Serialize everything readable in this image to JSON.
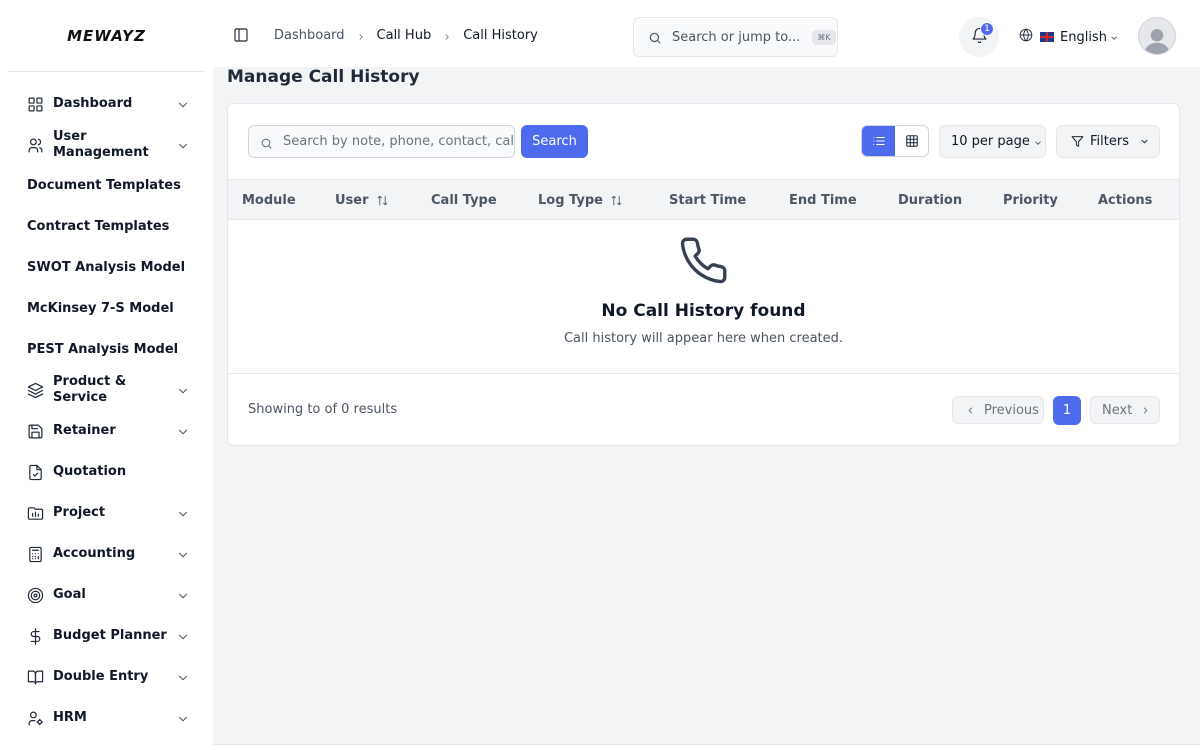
{
  "app": {
    "logo_text": "MEWAYZ"
  },
  "sidebar": {
    "items": [
      {
        "label": "Dashboard",
        "icon": "grid-icon",
        "has_chevron": true
      },
      {
        "label": "User Management",
        "icon": "users-icon",
        "has_chevron": true
      },
      {
        "label": "Document Templates",
        "icon": "",
        "has_chevron": false
      },
      {
        "label": "Contract Templates",
        "icon": "",
        "has_chevron": false
      },
      {
        "label": "SWOT Analysis Model",
        "icon": "",
        "has_chevron": false
      },
      {
        "label": "McKinsey 7-S Model",
        "icon": "",
        "has_chevron": false
      },
      {
        "label": "PEST Analysis Model",
        "icon": "",
        "has_chevron": false
      },
      {
        "label": "Product & Service",
        "icon": "layers-icon",
        "has_chevron": true
      },
      {
        "label": "Retainer",
        "icon": "save-icon",
        "has_chevron": true
      },
      {
        "label": "Quotation",
        "icon": "file-check-icon",
        "has_chevron": false
      },
      {
        "label": "Project",
        "icon": "chart-folder-icon",
        "has_chevron": true
      },
      {
        "label": "Accounting",
        "icon": "calculator-icon",
        "has_chevron": true
      },
      {
        "label": "Goal",
        "icon": "target-icon",
        "has_chevron": true
      },
      {
        "label": "Budget Planner",
        "icon": "dollar-icon",
        "has_chevron": true
      },
      {
        "label": "Double Entry",
        "icon": "book-icon",
        "has_chevron": true
      },
      {
        "label": "HRM",
        "icon": "user-cog-icon",
        "has_chevron": true
      }
    ]
  },
  "header": {
    "breadcrumb": [
      "Dashboard",
      "Call Hub",
      "Call History"
    ],
    "search_placeholder": "Search or jump to...",
    "search_shortcut": "⌘K",
    "notification_count": "1",
    "language": "English"
  },
  "page": {
    "title": "Manage Call History"
  },
  "toolbar": {
    "search_placeholder": "Search by note, phone, contact, call type",
    "search_button": "Search",
    "per_page": "10 per page",
    "filters_label": "Filters",
    "active_view": "list"
  },
  "table": {
    "columns": [
      {
        "label": "Module",
        "sortable": false
      },
      {
        "label": "User",
        "sortable": true
      },
      {
        "label": "Call Type",
        "sortable": false
      },
      {
        "label": "Log Type",
        "sortable": true
      },
      {
        "label": "Start Time",
        "sortable": false
      },
      {
        "label": "End Time",
        "sortable": false
      },
      {
        "label": "Duration",
        "sortable": false
      },
      {
        "label": "Priority",
        "sortable": false
      },
      {
        "label": "Actions",
        "sortable": false
      }
    ],
    "rows": [],
    "empty_title": "No Call History found",
    "empty_subtitle": "Call history will appear here when created."
  },
  "pagination": {
    "info": "Showing to of 0 results",
    "previous": "Previous",
    "next": "Next",
    "current_page": "1"
  },
  "colors": {
    "accent": "#4f6bed",
    "background": "#f3f4f6"
  }
}
